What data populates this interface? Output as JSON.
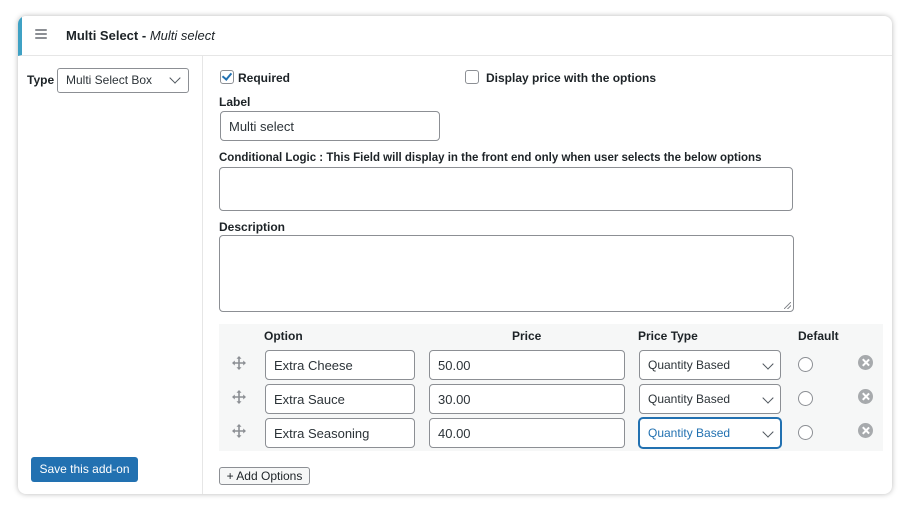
{
  "header": {
    "title": "Multi Select",
    "separator": " - ",
    "subtitle": "Multi select"
  },
  "sidebar": {
    "type_label": "Type",
    "type_value": "Multi Select Box",
    "save_label": "Save this add-on"
  },
  "form": {
    "required_label": "Required",
    "required_checked": true,
    "display_price_label": "Display price with the options",
    "display_price_checked": false,
    "label_heading": "Label",
    "label_value": "Multi select",
    "conditional_heading": "Conditional Logic : This Field will display in the front end only when user selects the below options",
    "conditional_value": "",
    "description_heading": "Description",
    "description_value": ""
  },
  "options_table": {
    "columns": [
      "Option",
      "Price",
      "Price Type",
      "Default"
    ],
    "rows": [
      {
        "option": "Extra Cheese",
        "price": "50.00",
        "price_type": "Quantity Based",
        "default": false
      },
      {
        "option": "Extra Sauce",
        "price": "30.00",
        "price_type": "Quantity Based",
        "default": false
      },
      {
        "option": "Extra Seasoning",
        "price": "40.00",
        "price_type": "Quantity Based",
        "default": false
      }
    ],
    "add_label": "+ Add Options"
  },
  "icons": {
    "menu": "hamburger-icon",
    "drag": "move-arrows-icon",
    "remove": "circle-x-icon",
    "dropdown": "chevron-down-icon"
  },
  "colors": {
    "accent": "#2271b1",
    "header_bar": "#3fa1c4",
    "table_bg": "#f6f7f7"
  }
}
